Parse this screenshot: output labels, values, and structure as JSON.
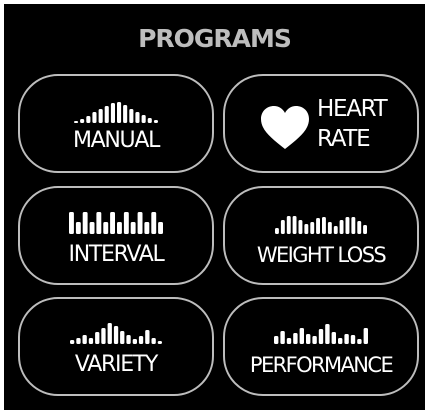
{
  "header": {
    "title": "PROGRAMS"
  },
  "programs": [
    {
      "id": "manual",
      "label": "MANUAL",
      "bar_heights": [
        2,
        4,
        7,
        11,
        14,
        17,
        20,
        21,
        18,
        14,
        11,
        8,
        5,
        3
      ]
    },
    {
      "id": "heart-rate",
      "label_line1": "HEART",
      "label_line2": "RATE",
      "icon": "heart-icon"
    },
    {
      "id": "interval",
      "label": "INTERVAL",
      "bar_heights": [
        22,
        12,
        22,
        12,
        22,
        12,
        22,
        12,
        22,
        12,
        22,
        12,
        22,
        12
      ]
    },
    {
      "id": "weight-loss",
      "label": "WEIGHT LOSS",
      "bar_heights": [
        6,
        14,
        18,
        18,
        14,
        10,
        12,
        16,
        17,
        12,
        8,
        14,
        17,
        17,
        13,
        9
      ]
    },
    {
      "id": "variety",
      "label": "VARIETY",
      "bar_heights": [
        4,
        6,
        9,
        6,
        12,
        16,
        21,
        18,
        13,
        9,
        5,
        8,
        14,
        6,
        3
      ]
    },
    {
      "id": "performance",
      "label": "PERFORMANCE",
      "bar_heights": [
        8,
        13,
        6,
        11,
        16,
        10,
        8,
        15,
        20,
        12,
        6,
        10,
        9,
        5,
        16
      ]
    }
  ],
  "colors": {
    "background": "#000000",
    "title": "#bdbdbd",
    "outline": "#bdbdbd",
    "text": "#ffffff"
  }
}
